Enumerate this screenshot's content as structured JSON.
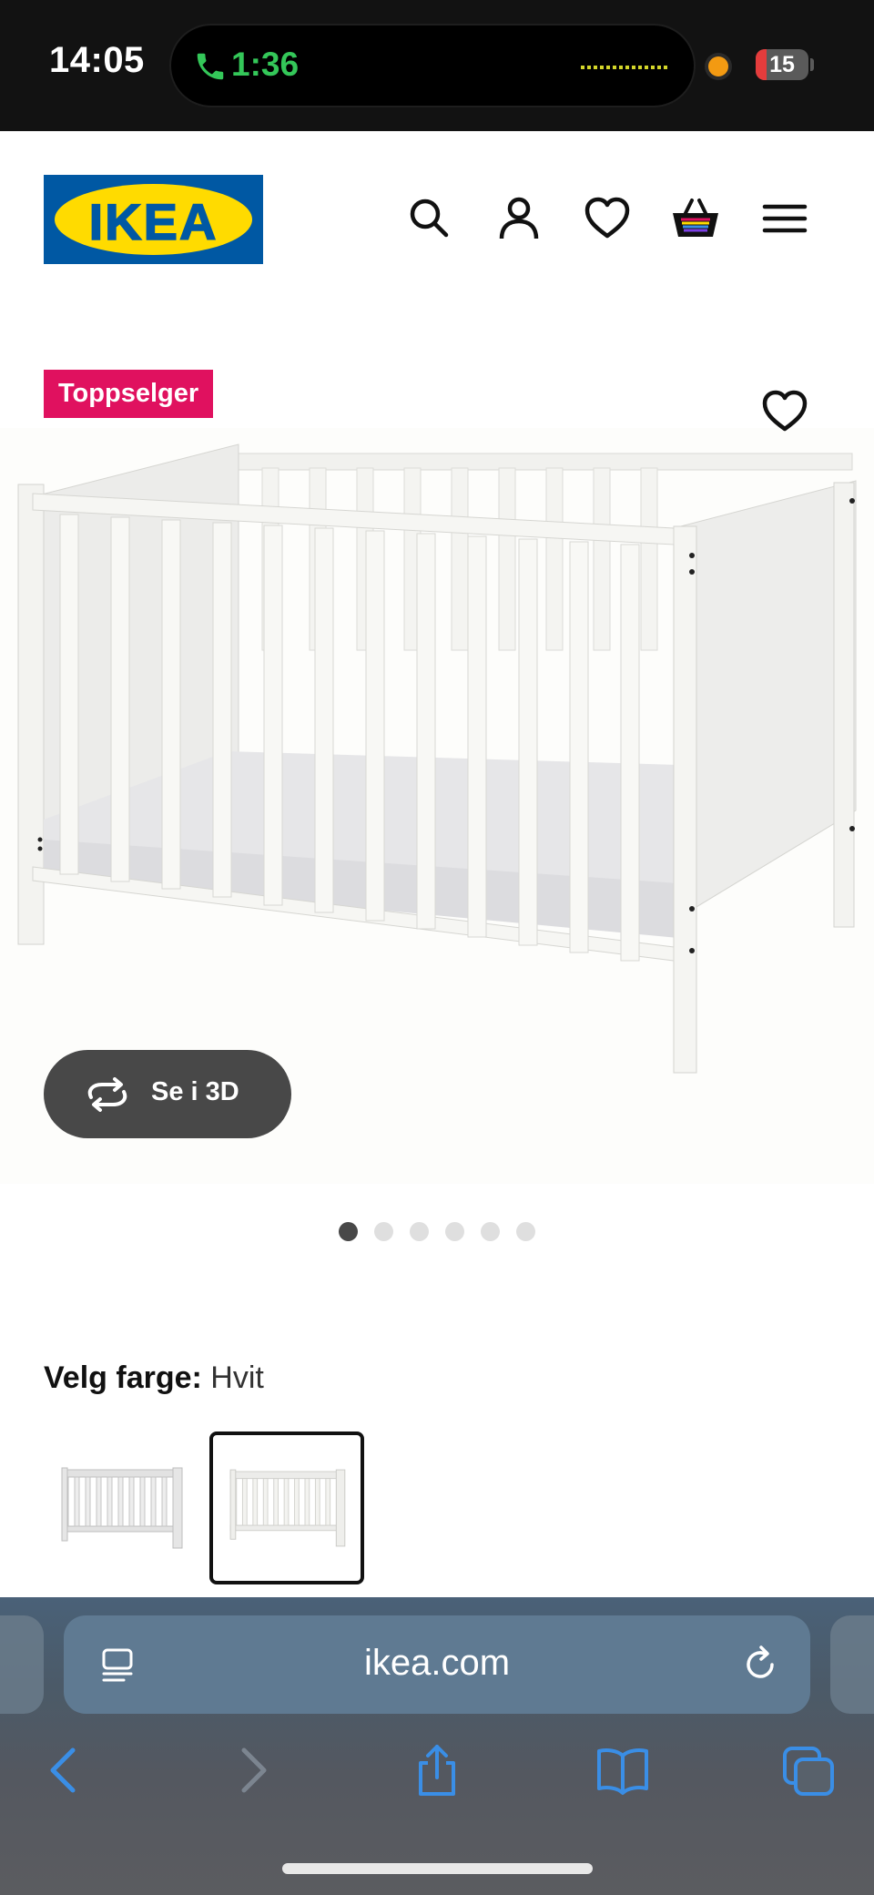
{
  "status_bar": {
    "time": "14:05",
    "call_timer": "1:36",
    "battery_level": "15",
    "icons": [
      "phone-icon",
      "battery-icon"
    ]
  },
  "header": {
    "logo_text": "IKEA",
    "icons": [
      "search-icon",
      "user-icon",
      "heart-icon",
      "basket-icon",
      "menu-icon"
    ]
  },
  "product": {
    "badge": "Toppselger",
    "view_3d_label": "Se i 3D",
    "image_count": 6,
    "active_image": 1
  },
  "color_select": {
    "label": "Velg farge:",
    "value": "Hvit",
    "options": [
      "Hvit",
      "Hvit"
    ],
    "selected_index": 1
  },
  "browser": {
    "url": "ikea.com",
    "toolbar": [
      "back-icon",
      "forward-icon",
      "share-icon",
      "bookmarks-icon",
      "tabs-icon"
    ]
  },
  "colors": {
    "ikea_blue": "#0058a3",
    "ikea_yellow": "#ffdb00",
    "badge_pink": "#e0115f",
    "safari_blue": "#3a8ee6"
  }
}
